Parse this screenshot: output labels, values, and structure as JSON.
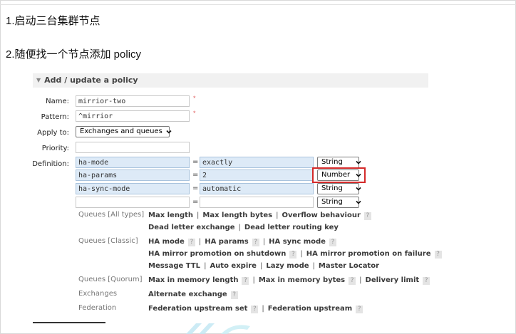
{
  "steps": [
    "1.启动三台集群节点",
    "2.随便找一个节点添加 policy"
  ],
  "panel": {
    "title": "Add / update a policy"
  },
  "form": {
    "name_label": "Name:",
    "name_value": "mirrior-two",
    "pattern_label": "Pattern:",
    "pattern_value": "^mirrior",
    "apply_label": "Apply to:",
    "apply_value": "Exchanges and queues",
    "priority_label": "Priority:",
    "priority_value": "",
    "definition_label": "Definition:",
    "required_mark": "*",
    "equals": "=",
    "definitions": [
      {
        "key": "ha-mode",
        "value": "exactly",
        "type": "String"
      },
      {
        "key": "ha-params",
        "value": "2",
        "type": "Number"
      },
      {
        "key": "ha-sync-mode",
        "value": "automatic",
        "type": "String"
      },
      {
        "key": "",
        "value": "",
        "type": "String"
      }
    ]
  },
  "help": {
    "qmark": "?",
    "groups": [
      {
        "label": "Queues [All types]"
      },
      {
        "label": "Queues [Classic]"
      },
      {
        "label": "Queues [Quorum]"
      },
      {
        "label": "Exchanges"
      },
      {
        "label": "Federation"
      }
    ],
    "all_types_1": [
      "Max length",
      "Max length bytes",
      "Overflow behaviour"
    ],
    "all_types_2": [
      "Dead letter exchange",
      "Dead letter routing key"
    ],
    "classic_1": [
      "HA mode",
      "HA params",
      "HA sync mode"
    ],
    "classic_2": [
      "HA mirror promotion on shutdown",
      "HA mirror promotion on failure"
    ],
    "classic_3": [
      "Message TTL",
      "Auto expire",
      "Lazy mode",
      "Master Locator"
    ],
    "quorum": [
      "Max in memory length",
      "Max in memory bytes",
      "Delivery limit"
    ],
    "exchanges": [
      "Alternate exchange"
    ],
    "federation": [
      "Federation upstream set",
      "Federation upstream"
    ]
  },
  "colors": {
    "highlight": "#d42a2a",
    "definition_bg": "#ddeaf7",
    "panel_bg": "#f1f1f1"
  }
}
